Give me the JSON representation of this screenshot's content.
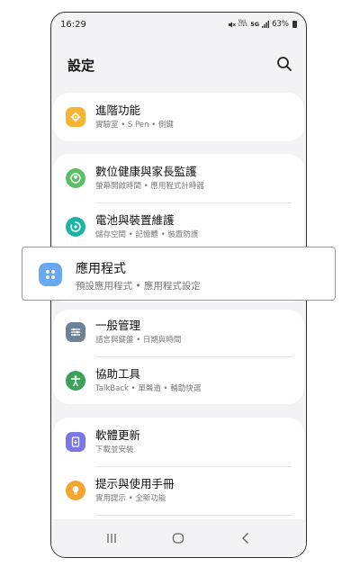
{
  "status_bar": {
    "time": "16:29",
    "battery": "63%",
    "net_top": "Vol)",
    "net_bottom": "LTE1",
    "signal": "5G"
  },
  "header": {
    "title": "設定"
  },
  "items": [
    {
      "title": "進階功能",
      "subtitle": "實驗室 • S Pen • 側鍵",
      "color": "#f5b533"
    },
    {
      "title": "數位健康與家長監護",
      "subtitle": "螢幕開啟時間 • 應用程式計時器",
      "color": "#5cbf66"
    },
    {
      "title": "電池與裝置維護",
      "subtitle": "儲存空間 • 記憶體 • 裝置防護",
      "color": "#1cb5a3"
    },
    {
      "title": "應用程式",
      "subtitle": "預設應用程式 • 應用程式設定",
      "color": "#6aa8ef"
    },
    {
      "title": "一般管理",
      "subtitle": "語言與鍵盤 • 日期與時間",
      "color": "#6f8196"
    },
    {
      "title": "協助工具",
      "subtitle": "TalkBack • 單聲道 • 輔助快選",
      "color": "#3aa05a"
    },
    {
      "title": "軟體更新",
      "subtitle": "下載並安裝",
      "color": "#7b78e6"
    },
    {
      "title": "提示與使用手冊",
      "subtitle": "實用提示 • 全新功能",
      "color": "#f5a531"
    }
  ]
}
